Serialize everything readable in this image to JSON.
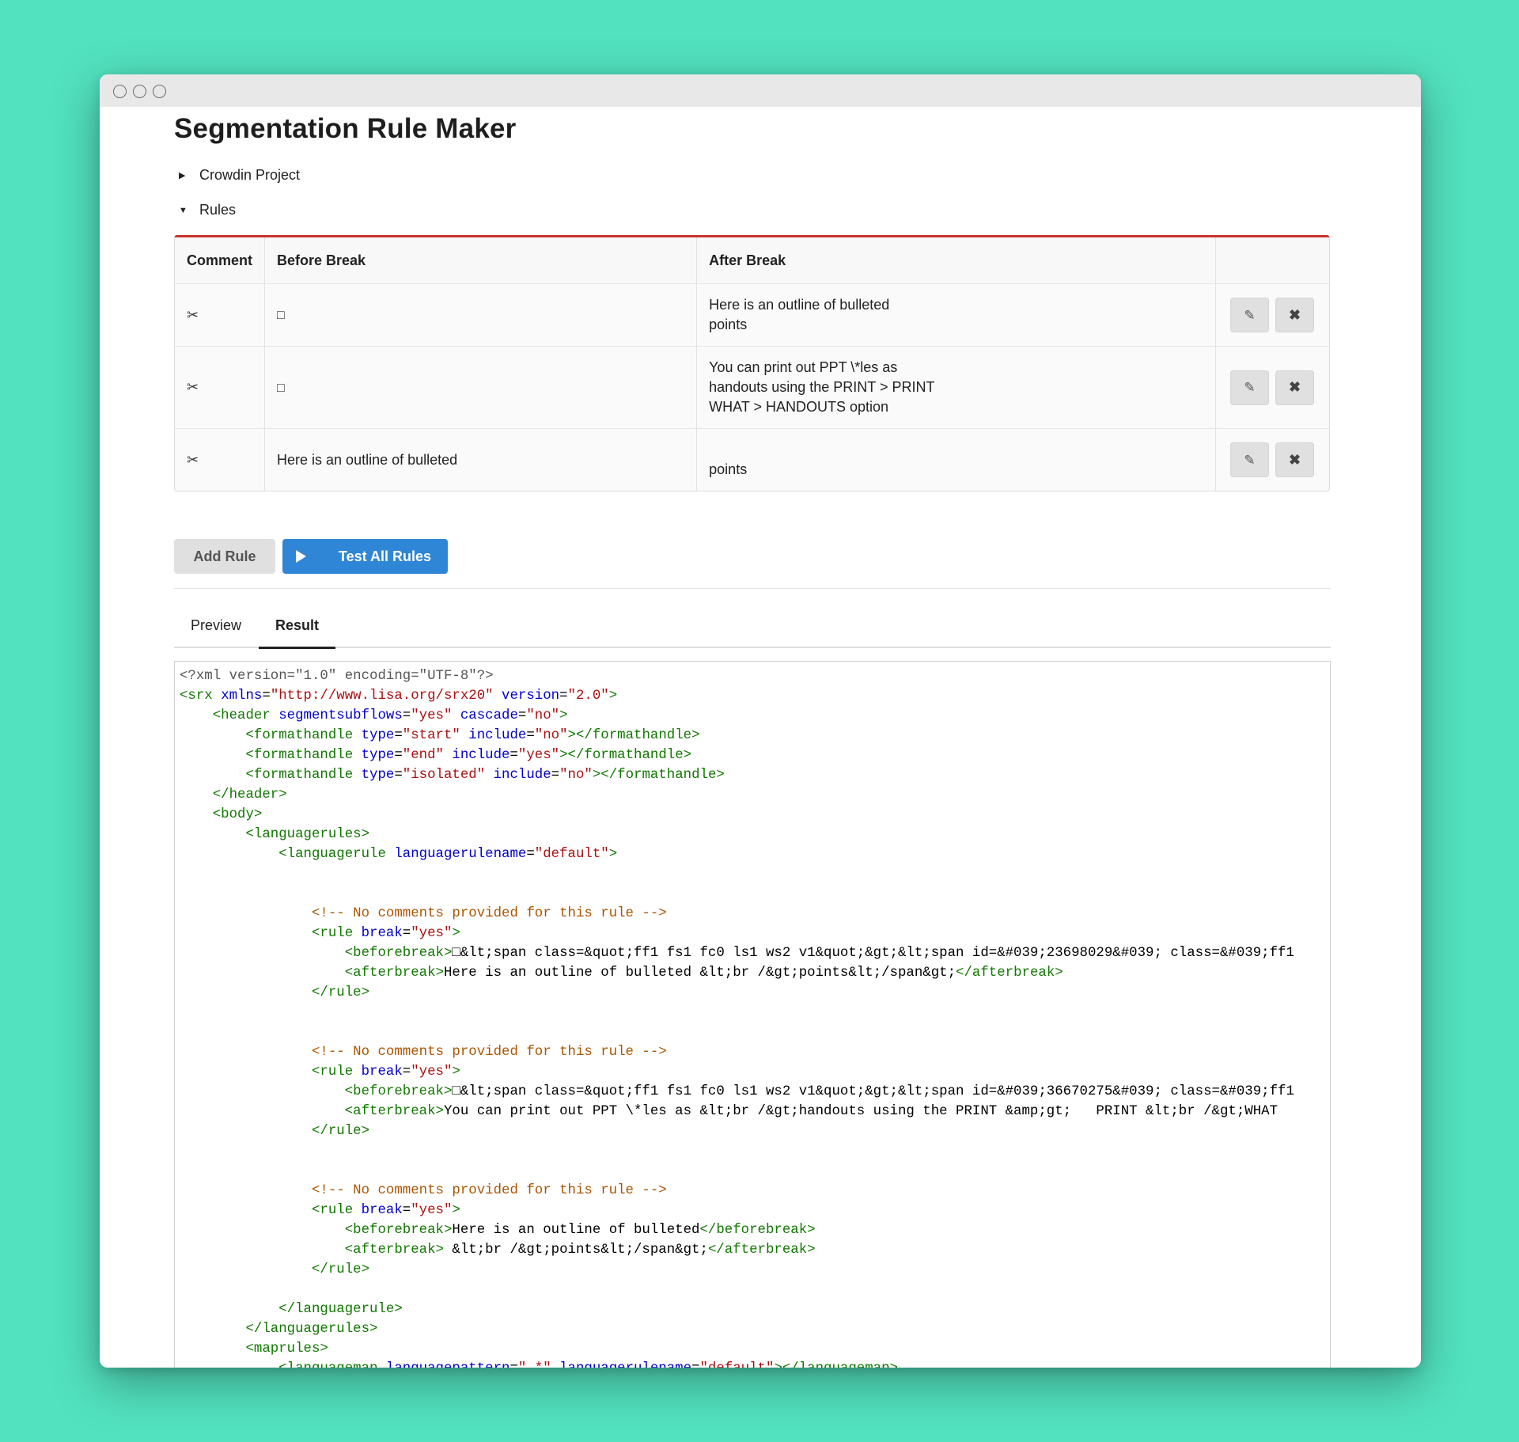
{
  "window": {
    "title": "Segmentation Rule Maker"
  },
  "sections": {
    "project_label": "Crowdin Project",
    "rules_label": "Rules"
  },
  "table": {
    "headers": [
      "Comment",
      "Before Break",
      "After Break",
      ""
    ],
    "rows": [
      {
        "comment_icon": "scissors-icon",
        "before": "□",
        "after": "Here is an outline of bulleted\npoints"
      },
      {
        "comment_icon": "scissors-icon",
        "before": "□",
        "after": "You can print out PPT \\*les as\nhandouts using the PRINT > PRINT\nWHAT > HANDOUTS option"
      },
      {
        "comment_icon": "scissors-icon",
        "before": "Here is an outline of bulleted",
        "after": "points"
      }
    ]
  },
  "buttons": {
    "add_rule": "Add Rule",
    "test_all": "Test All Rules"
  },
  "tabs": [
    {
      "label": "Preview",
      "active": false
    },
    {
      "label": "Result",
      "active": true
    }
  ],
  "code": {
    "xml_decl": "<?xml version=\"1.0\" encoding=\"UTF-8\"?>",
    "srx_ns": "\"http://www.lisa.org/srx20\"",
    "srx_version": "\"2.0\"",
    "comment": "<!-- No comments provided for this rule -->",
    "rule1_before": "□&lt;span class=&quot;ff1 fs1 fc0 ls1 ws2 v1&quot;&gt;&lt;span id=&#039;23698029&#039; class=&#039;ff1",
    "rule1_after": "Here is an outline of bulleted &lt;br /&gt;points&lt;/span&gt;",
    "rule2_before": "□&lt;span class=&quot;ff1 fs1 fc0 ls1 ws2 v1&quot;&gt;&lt;span id=&#039;36670275&#039; class=&#039;ff1",
    "rule2_after": "You can print out PPT \\*les as &lt;br /&gt;handouts using the PRINT &amp;gt;   PRINT &lt;br /&gt;WHAT",
    "rule3_before": "Here is an outline of bulleted",
    "rule3_after": " &lt;br /&gt;points&lt;/span&gt;",
    "language_rule_name": "\"default\"",
    "language_pattern": "\".*\""
  },
  "colors": {
    "background": "#52e2bf",
    "accent_border": "#c9332b",
    "primary_button": "#2f86d6",
    "xml_tag": "#117700",
    "xml_attr": "#0000cc",
    "xml_string": "#aa1111",
    "xml_comment": "#aa5500"
  }
}
